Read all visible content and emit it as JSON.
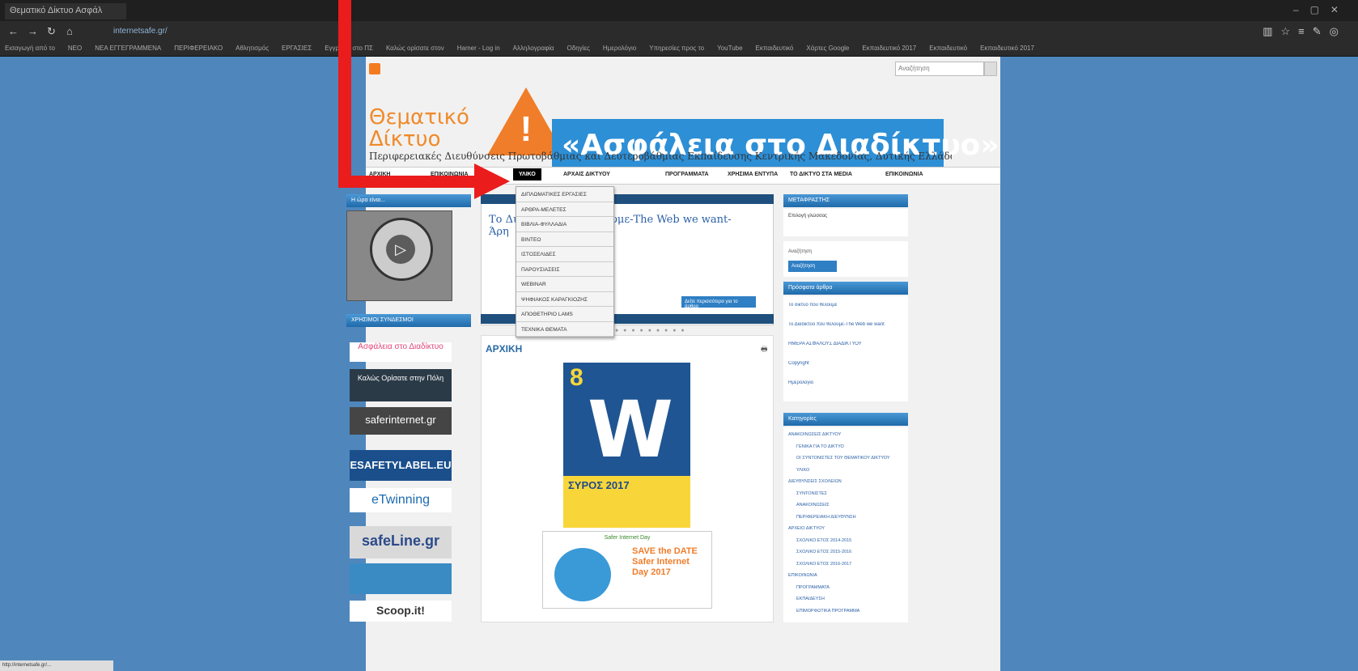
{
  "browser": {
    "tab_title": "Θεματικό Δίκτυο Ασφάλ",
    "address": "internetsafe.gr/",
    "favorites": [
      "Εισαγωγή από το",
      "NEO",
      "ΝΕΑ ΕΓΓΕΓΡΑΜΜΕΝΑ",
      "ΠΕΡΙΦΕΡΕΙΑΚΟ",
      "Αθλητισμός",
      "ΕΡΓΑΣΙΕΣ",
      "Εγγραφή στο ΠΣ",
      "Καλώς ορίσατε στον",
      "Hamer - Log in",
      "Αλληλογραφία",
      "Οδηγίες",
      "Ημερολόγιο",
      "Υπηρεσίες προς το",
      "YouTube",
      "Εκπαιδευτικό",
      "Χάρτες Google",
      "Εκπαιδευτικό 2017",
      "Εκπαιδευτικό",
      "Εκπαιδευτικό 2017"
    ],
    "status_url": "http://internetsafe.gr/..."
  },
  "header": {
    "search_placeholder": "Αναζήτηση",
    "logo_line1": "Θεματικό",
    "logo_line2": "Δίκτυο",
    "warning_glyph": "!",
    "banner": "«Ασφάλεια στο Διαδίκτυο»",
    "subtitle": "Περιφερειακές Διευθύνσεις Πρωτοβάθμιας και Δευτεροβάθμιας Εκπαίδευσης Κεντρικής Μακεδονίας, Δυτικής Ελλάδας και Κρήτης"
  },
  "menu": {
    "active": "ΥΛΙΚΟ",
    "items": [
      "ΑΡΧΙΚΗ",
      "ΕΠΙΚΟΙΝΩΝΙΑ",
      "ΥΛΙΚΟ",
      "ΑΡΧΑΙΣ ΔΙΚΤΥΟΥ",
      "ΠΡΟΓΡΑΜΜΑΤΑ",
      "ΧΡΗΣΙΜΑ ΕΝΤΥΠΑ",
      "ΤΟ ΔΙΚΤΥΟ ΣΤΑ MEDIA",
      "ΕΠΙΚΟΙΝΩΝΙΑ"
    ]
  },
  "dropdown": {
    "items": [
      "ΔΙΠΛΩΜΑΤΙΚΕΣ ΕΡΓΑΣΙΕΣ",
      "ΑΡΘΡΑ-ΜΕΛΕΤΕΣ",
      "ΒΙΒΛΙΑ-ΦΥΛΛΑΔΙΑ",
      "ΒΙΝΤΕΟ",
      "ΙΣΤΟΣΕΛΙΔΕΣ",
      "ΠΑΡΟΥΣΙΑΣΕΙΣ",
      "WEBINAR",
      "ΨΗΦΙΑΚΟΣ ΚΑΡΑΓΚΙΟΖΗΣ",
      "ΑΠΟΘΕΤΗΡΙΟ LAMS",
      "ΤΕΧΝΙΚΑ ΘΕΜΑΤΑ"
    ]
  },
  "left": {
    "box1_title": "Η ώρα είναι...",
    "play_glyph": "▷",
    "box2_title": "ΧΡΗΣΙΜΟΙ ΣΥΝΔΕΣΜΟΙ",
    "links": [
      "Ασφάλεια στο Διαδίκτυο",
      "Καλώς Ορίσατε στην Πόλη",
      "saferinternet.gr",
      "ESAFETYLABEL.EU",
      "eTwinning",
      "safeLine.gr",
      "Scoop.it!"
    ]
  },
  "center": {
    "slide_title": "Το Διαδίκτυο που θέλουμε-The Web we want-",
    "slide_title2": "Άρη",
    "more_button": "Δείτε περισσότερα για το άρθρο",
    "dots": "● ● ● ● ● ● ● ● ●",
    "article_heading": "ΑΡΧΙΚΗ",
    "print_glyph": "🖶",
    "poster_number": "8",
    "poster_letter": "W",
    "poster_city": "ΣΥΡΟΣ 2017",
    "sid_title": "Safer Internet Day",
    "sid_text": "SAVE the DATE Safer Internet Day 2017"
  },
  "right": {
    "translator_title": "ΜΕΤΑΦΡΑΣΤΗΣ",
    "select_lang": "Επιλογή γλώσσας",
    "search_title": "Αναζήτηση",
    "search_button": "Αναζήτηση",
    "recent_title": "Πρόσφατα άρθρα",
    "recent": [
      "Το δίκτυο που θέλουμε",
      "Το Διαδίκτυο που θέλουμε-The Web we want",
      "ΗΜΕΡΑ ΑΣΦΑΛΟΥΣ ΔΙΑΔΙΚΤΥΟΥ",
      "Copyright",
      "Ημερολόγιο"
    ],
    "categories_title": "Κατηγορίες",
    "categories": [
      "ΑΝΑΚΟΙΝΩΣΕΙΣ ΔΙΚΤΥΟΥ",
      "ΓΕΝΙΚΑ ΓΙΑ ΤΟ ΔΙΚΤΥΟ",
      "ΟΙ ΣΥΝΤΟΝΙΣΤΕΣ ΤΟΥ ΘΕΜΑΤΙΚΟΥ ΔΙΚΤΥΟΥ",
      "ΥΛΙΚΟ",
      "ΔΙΕΥΘΥΝΣΕΙΣ ΣΧΟΛΕΙΩΝ",
      "ΣΥΝΤΟΝΙΣΤΕΣ",
      "ΑΝΑΚΟΙΝΩΣΕΙΣ",
      "ΠΕΡΙΦΕΡΕΙΑΚΗ ΔΙΕΥΘΥΝΣΗ",
      "ΑΡΧΕΙΟ ΔΙΚΤΥΟΥ",
      "ΣΧΟΛΙΚΟ ΕΤΟΣ 2014-2015",
      "ΣΧΟΛΙΚΟ ΕΤΟΣ 2015-2016",
      "ΣΧΟΛΙΚΟ ΕΤΟΣ 2016-2017",
      "ΕΠΙΚΟΙΝΩΝΙΑ",
      "ΠΡΟΓΡΑΜΜΑΤΑ",
      "ΕΚΠΑΙΔΕΥΣΗ",
      "ΕΠΙΜΟΡΦΩΤΙΚΑ ΠΡΟΓΡΑΜΜΑ"
    ]
  }
}
